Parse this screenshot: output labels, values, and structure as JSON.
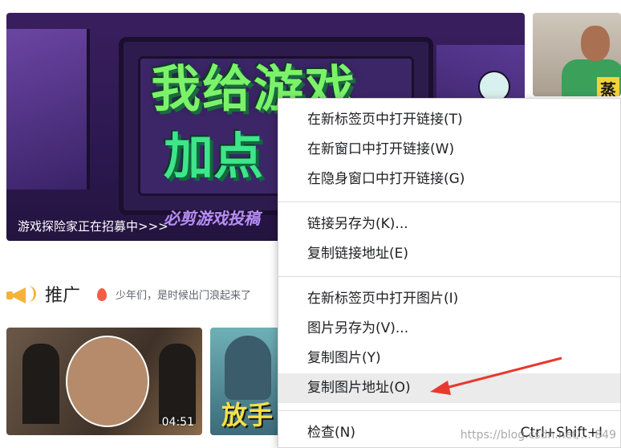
{
  "banner": {
    "title_line1": "我给游戏",
    "title_line2": "加点",
    "subtitle": "必剪游戏投稿",
    "caption": "游戏探险家正在招募中>>>"
  },
  "promo": {
    "label": "推广",
    "tip": "少年们，是时候出门浪起来了"
  },
  "side_thumb": {
    "sign_text": "蒸"
  },
  "videos": [
    {
      "duration": "04:51"
    },
    {
      "overlay_text": "放手"
    }
  ],
  "context_menu": {
    "group1": [
      "在新标签页中打开链接(T)",
      "在新窗口中打开链接(W)",
      "在隐身窗口中打开链接(G)"
    ],
    "group2": [
      "链接另存为(K)...",
      "复制链接地址(E)"
    ],
    "group3": [
      "在新标签页中打开图片(I)",
      "图片另存为(V)...",
      "复制图片(Y)",
      "复制图片地址(O)"
    ],
    "inspect": {
      "label": "检查(N)",
      "shortcut": "Ctrl+Shift+I"
    }
  },
  "watermark": "https://blog.csdn.net/... 849",
  "colors": {
    "arrow": "#e8392f",
    "promo_icon": "#f4b338",
    "hover_row": "#ebebeb"
  }
}
